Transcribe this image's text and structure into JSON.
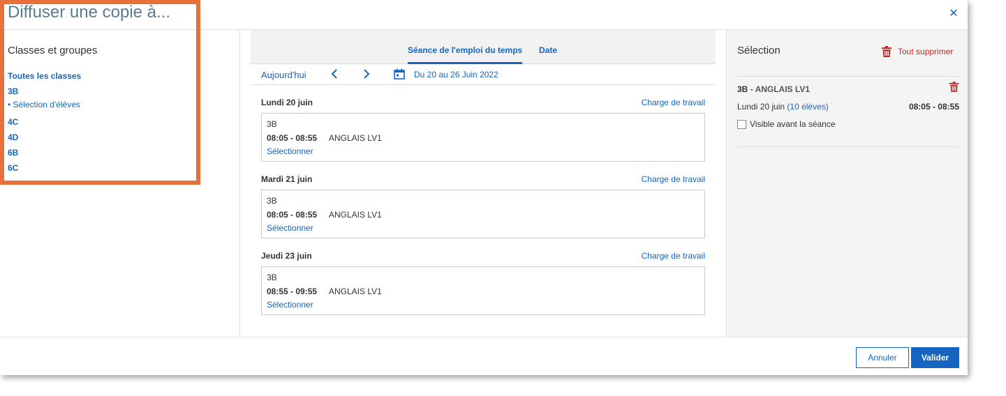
{
  "dialog": {
    "title": "Diffuser une copie à...",
    "close_icon": "close-icon"
  },
  "left": {
    "heading": "Classes et groupes",
    "items": [
      {
        "label": "Toutes les classes",
        "kind": "class"
      },
      {
        "label": "3B",
        "kind": "class"
      },
      {
        "label": "• Sélection d'élèves",
        "kind": "sub"
      },
      {
        "label": "4C",
        "kind": "class"
      },
      {
        "label": "4D",
        "kind": "class"
      },
      {
        "label": "6B",
        "kind": "class"
      },
      {
        "label": "6C",
        "kind": "class"
      }
    ]
  },
  "center": {
    "tabs": [
      {
        "label": "Séance de l'emploi du temps",
        "active": true
      },
      {
        "label": "Date",
        "active": false
      }
    ],
    "nav": {
      "today": "Aujourd'hui",
      "range": "Du 20 au 26 Juin 2022",
      "prev_icon": "chevron-left-icon",
      "next_icon": "chevron-right-icon",
      "calendar_icon": "calendar-icon"
    },
    "days": [
      {
        "title": "Lundi 20 juin",
        "workload": "Charge de travail",
        "class": "3B",
        "time": "08:05 - 08:55",
        "subject": "ANGLAIS LV1",
        "select": "Sélectionner"
      },
      {
        "title": "Mardi 21 juin",
        "workload": "Charge de travail",
        "class": "3B",
        "time": "08:05 - 08:55",
        "subject": "ANGLAIS LV1",
        "select": "Sélectionner"
      },
      {
        "title": "Jeudi 23 juin",
        "workload": "Charge de travail",
        "class": "3B",
        "time": "08:55 - 09:55",
        "subject": "ANGLAIS LV1",
        "select": "Sélectionner"
      }
    ]
  },
  "right": {
    "title": "Sélection",
    "delete_all": "Tout supprimer",
    "item": {
      "class": "3B",
      "separator": " - ",
      "subject": "ANGLAIS LV1",
      "day": "Lundi 20 juin",
      "students": "(10 élèves)",
      "time": "08:05 - 08:55",
      "visible_label": "Visible avant la séance",
      "visible_checked": false
    }
  },
  "footer": {
    "cancel": "Annuler",
    "ok": "Valider"
  },
  "colors": {
    "accent": "#1565c0",
    "danger": "#c62828",
    "title": "#5a7a8e",
    "highlight_frame": "#e8703a"
  }
}
